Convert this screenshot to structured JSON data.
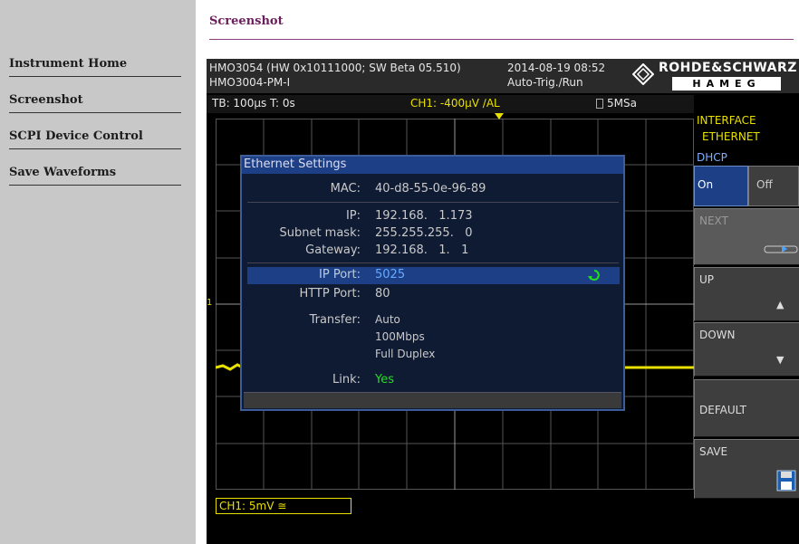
{
  "sidebar": {
    "items": [
      {
        "label": "Instrument Home"
      },
      {
        "label": "Screenshot"
      },
      {
        "label": "SCPI Device Control"
      },
      {
        "label": "Save Waveforms"
      }
    ]
  },
  "page": {
    "title": "Screenshot"
  },
  "scope": {
    "model_line1": "HMO3054 (HW 0x10111000; SW Beta 05.510)",
    "model_line2": "HMO3004-PM-I",
    "datetime": "2014-08-19 08:52",
    "trigger_mode": "Auto-Trig./Run",
    "brand_top": "ROHDE&SCHWARZ",
    "brand_bottom": "HAMEG",
    "timebase": "TB: 100µs  T: 0s",
    "trigger": "CH1: -400µV ∕AL",
    "sample_rate": "5MSa",
    "channel_label": "CH1: 5mV ≅",
    "marker": "1"
  },
  "menu": {
    "header_line1": "INTERFACE",
    "header_line2": "ETHERNET",
    "dhcp_label": "DHCP",
    "dhcp_on": "On",
    "dhcp_off": "Off",
    "next": "NEXT",
    "up": "UP",
    "down": "DOWN",
    "default": "DEFAULT",
    "save": "SAVE",
    "up_arrow": "▲",
    "down_arrow": "▼"
  },
  "dialog": {
    "title": "Ethernet Settings",
    "mac_label": "MAC:",
    "mac_value": "40-d8-55-0e-96-89",
    "ip_label": "IP:",
    "ip_value": "192.168.   1.173",
    "subnet_label": "Subnet mask:",
    "subnet_value": "255.255.255.   0",
    "gateway_label": "Gateway:",
    "gateway_value": "192.168.   1.   1",
    "ipport_label": "IP Port:",
    "ipport_value": "5025",
    "httpport_label": "HTTP Port:",
    "httpport_value": "80",
    "transfer_label": "Transfer:",
    "transfer_value1": "Auto",
    "transfer_value2": "100Mbps",
    "transfer_value3": "Full Duplex",
    "link_label": "Link:",
    "link_value": "Yes"
  },
  "colors": {
    "accent": "#6a1f5c",
    "trace": "#e8e000",
    "selected": "#1c3f86",
    "link_ok": "#22dd22",
    "highlight_value": "#66aaff"
  }
}
